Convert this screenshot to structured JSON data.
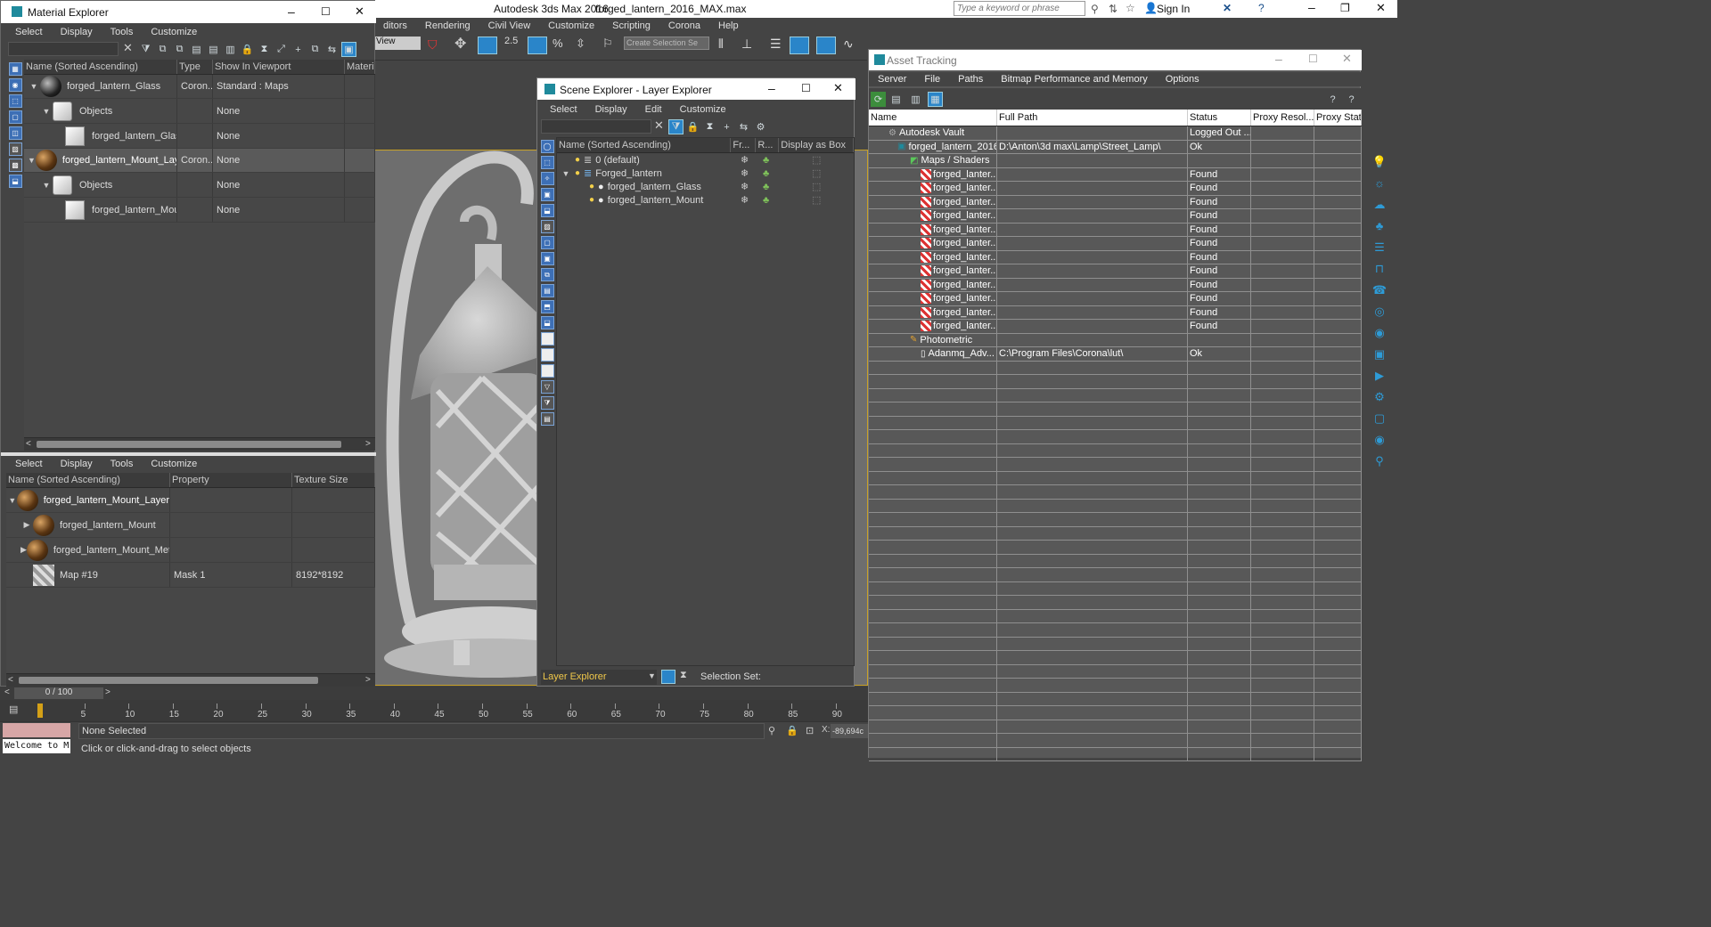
{
  "app": {
    "title": "Autodesk 3ds Max 2016",
    "file": "forged_lantern_2016_MAX.max",
    "search_placeholder": "Type a keyword or phrase",
    "sign_in": "Sign In",
    "menus": [
      "ditors",
      "Rendering",
      "Civil View",
      "Customize",
      "Scripting",
      "Corona",
      "Help"
    ],
    "viewport_dropdown": "View",
    "selection_set_placeholder": "Create Selection Se",
    "snap_value": "2.5"
  },
  "material_explorer": {
    "title": "Material Explorer",
    "menu": [
      "Select",
      "Display",
      "Tools",
      "Customize"
    ],
    "columns": [
      "Name (Sorted Ascending)",
      "Type",
      "Show In Viewport",
      "Material"
    ],
    "rows": [
      {
        "name": "forged_lantern_Glass",
        "type": "Coron...",
        "show": "Standard : Maps"
      },
      {
        "name": "Objects",
        "type": "",
        "show": "None"
      },
      {
        "name": "forged_lantern_Glass",
        "type": "",
        "show": "None"
      },
      {
        "name": "forged_lantern_Mount_Layer",
        "type": "Coron...",
        "show": "None"
      },
      {
        "name": "Objects",
        "type": "",
        "show": "None"
      },
      {
        "name": "forged_lantern_Mount",
        "type": "",
        "show": "None"
      }
    ],
    "bottom_menu": [
      "Select",
      "Display",
      "Tools",
      "Customize"
    ],
    "bottom_columns": [
      "Name (Sorted Ascending)",
      "Property",
      "Texture Size"
    ],
    "bottom_rows": [
      {
        "name": "forged_lantern_Mount_Layer",
        "property": "",
        "size": ""
      },
      {
        "name": "forged_lantern_Mount",
        "property": "",
        "size": ""
      },
      {
        "name": "forged_lantern_Mount_Metal",
        "property": "",
        "size": ""
      },
      {
        "name": "Map #19",
        "property": "Mask 1",
        "size": "8192*8192"
      }
    ]
  },
  "scene_explorer": {
    "title": "Scene Explorer - Layer Explorer",
    "menu": [
      "Select",
      "Display",
      "Edit",
      "Customize"
    ],
    "columns": [
      "Name (Sorted Ascending)",
      "Fr...",
      "R...",
      "Display as Box"
    ],
    "rows": [
      "0 (default)",
      "Forged_lantern",
      "forged_lantern_Glass",
      "forged_lantern_Mount"
    ],
    "footer_dropdown": "Layer Explorer",
    "selection_set_label": "Selection Set:"
  },
  "asset_tracking": {
    "title": "Asset Tracking",
    "menu": [
      "Server",
      "File",
      "Paths",
      "Bitmap Performance and Memory",
      "Options"
    ],
    "columns": [
      "Name",
      "Full Path",
      "Status",
      "Proxy Resol...",
      "Proxy Statu"
    ],
    "vault": {
      "name": "Autodesk Vault",
      "status": "Logged Out ..."
    },
    "file": {
      "name": "forged_lantern_2016...",
      "path": "D:\\Anton\\3d max\\Lamp\\Street_Lamp\\",
      "status": "Ok"
    },
    "maps_group": "Maps / Shaders",
    "map_item_name": "forged_lanter...",
    "map_item_status": "Found",
    "map_count": 12,
    "photometric_group": "Photometric",
    "photometric_item": {
      "name": "Adanmq_Adv...",
      "path": "C:\\Program Files\\Corona\\lut\\",
      "status": "Ok"
    }
  },
  "timeline": {
    "frame_counter": "0 / 100",
    "ticks": [
      "5",
      "10",
      "15",
      "20",
      "25",
      "30",
      "35",
      "40",
      "45",
      "50",
      "55",
      "60",
      "65",
      "70",
      "75",
      "80",
      "85",
      "90"
    ]
  },
  "status": {
    "maxscript": "Welcome to M",
    "selection": "None Selected",
    "prompt": "Click or click-and-drag to select objects",
    "coord_x": "-89,694c"
  }
}
